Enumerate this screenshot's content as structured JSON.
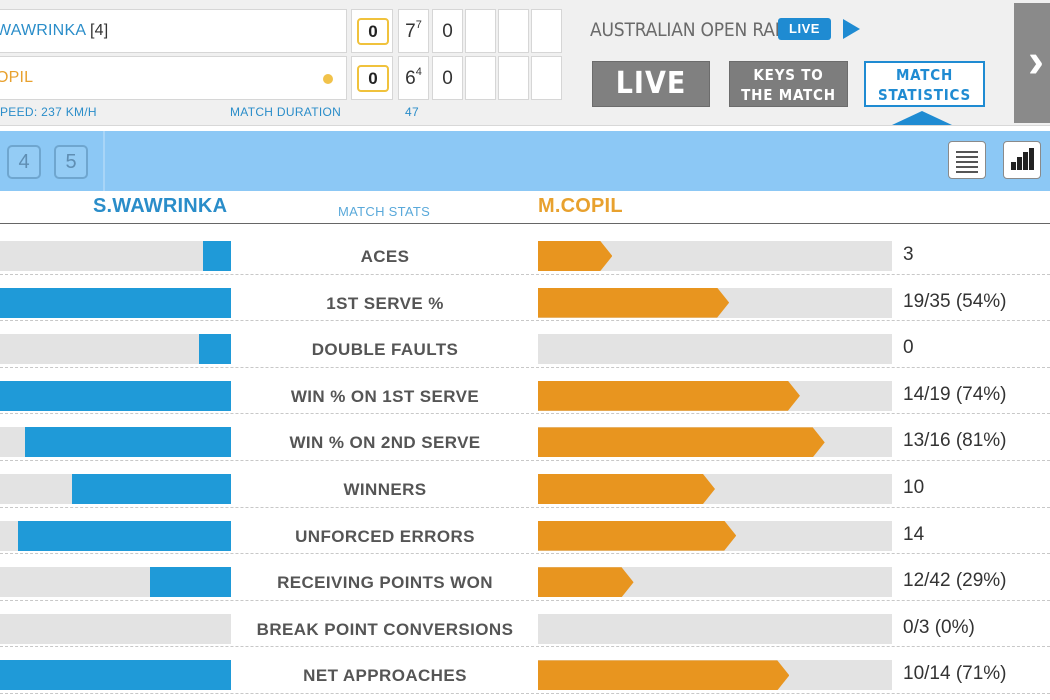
{
  "scoreboard": {
    "player1": {
      "name": "WAWRINKA",
      "seed": "[4]",
      "game": "0",
      "sets": [
        {
          "v": "7",
          "tb": "7"
        },
        {
          "v": "0",
          "tb": ""
        }
      ]
    },
    "player2": {
      "name": "OPIL",
      "game": "0",
      "sets": [
        {
          "v": "6",
          "tb": "4"
        },
        {
          "v": "0",
          "tb": ""
        }
      ]
    },
    "speed": "PEED: 237 KM/H",
    "duration_label": "MATCH DURATION",
    "duration_value": "47"
  },
  "radio": {
    "title": "AUSTRALIAN OPEN RADIO",
    "badge": "LIVE"
  },
  "buttons": {
    "live": "LIVE",
    "keys_line1": "KEYS TO",
    "keys_line2": "THE MATCH",
    "stats_line1": "MATCH",
    "stats_line2": "STATISTICS"
  },
  "toolbar": {
    "set_tabs": [
      "4",
      "5"
    ]
  },
  "stats_header": {
    "left": "S.WAWRINKA",
    "middle": "MATCH STATS",
    "right": "M.COPIL"
  },
  "stats": [
    {
      "label": "ACES",
      "left_pct": 12,
      "right_pct": 21,
      "right_value": "3"
    },
    {
      "label": "1ST SERVE %",
      "left_pct": 100,
      "right_pct": 54,
      "right_value": "19/35 (54%)"
    },
    {
      "label": "DOUBLE FAULTS",
      "left_pct": 14,
      "right_pct": 0,
      "right_value": "0"
    },
    {
      "label": "WIN % ON 1ST SERVE",
      "left_pct": 100,
      "right_pct": 74,
      "right_value": "14/19 (74%)"
    },
    {
      "label": "WIN % ON 2ND SERVE",
      "left_pct": 89,
      "right_pct": 81,
      "right_value": "13/16 (81%)"
    },
    {
      "label": "WINNERS",
      "left_pct": 69,
      "right_pct": 50,
      "right_value": "10"
    },
    {
      "label": "UNFORCED ERRORS",
      "left_pct": 92,
      "right_pct": 56,
      "right_value": "14"
    },
    {
      "label": "RECEIVING POINTS WON",
      "left_pct": 35,
      "right_pct": 27,
      "right_value": "12/42 (29%)"
    },
    {
      "label": "BREAK POINT CONVERSIONS",
      "left_pct": 0,
      "right_pct": 0,
      "right_value": "0/3 (0%)"
    },
    {
      "label": "NET APPROACHES",
      "left_pct": 100,
      "right_pct": 71,
      "right_value": "10/14 (71%)"
    }
  ]
}
